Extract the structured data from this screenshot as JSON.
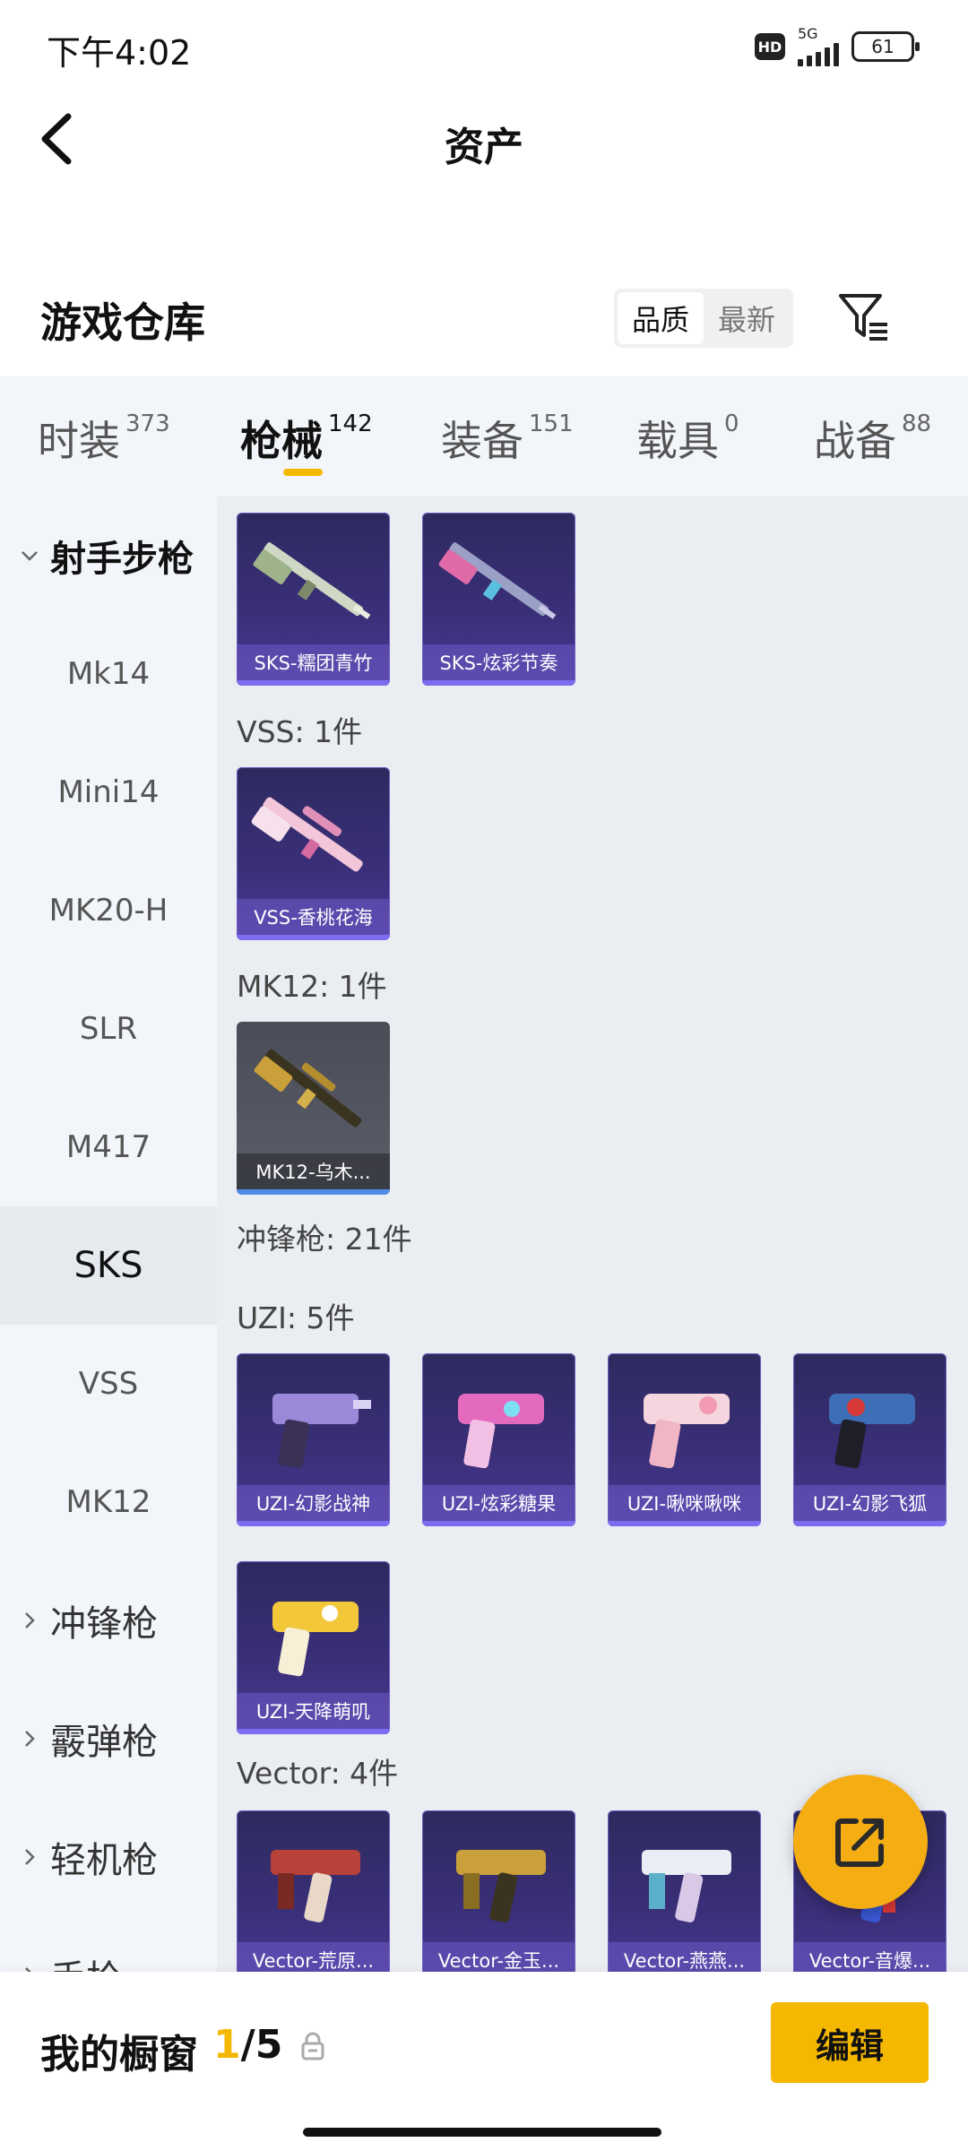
{
  "status_bar": {
    "time": "下午4:02",
    "hd": "HD",
    "network": "5G",
    "battery": "61"
  },
  "header": {
    "title": "资产"
  },
  "warehouse": {
    "title": "游戏仓库",
    "sort_options": [
      "品质",
      "最新"
    ],
    "active_sort": "品质"
  },
  "tabs": [
    {
      "label": "时装",
      "count": "373"
    },
    {
      "label": "枪械",
      "count": "142",
      "active": true
    },
    {
      "label": "装备",
      "count": "151"
    },
    {
      "label": "载具",
      "count": "0"
    },
    {
      "label": "战备",
      "count": "88"
    }
  ],
  "sidebar": {
    "group_expanded": "射手步枪",
    "items": [
      "Mk14",
      "Mini14",
      "MK20-H",
      "SLR",
      "M417",
      "SKS",
      "VSS",
      "MK12"
    ],
    "selected": "SKS",
    "collapsed_groups": [
      "冲锋枪",
      "霰弹枪",
      "轻机枪",
      "手枪"
    ]
  },
  "content": {
    "sks_cards": [
      "SKS-糯团青竹",
      "SKS-炫彩节奏"
    ],
    "vss_label": "VSS: 1件",
    "vss_cards": [
      "VSS-香桃花海"
    ],
    "mk12_label": "MK12: 1件",
    "mk12_cards": [
      "MK12-乌木..."
    ],
    "smg_label": "冲锋枪: 21件",
    "uzi_label": "UZI: 5件",
    "uzi_cards": [
      "UZI-幻影战神",
      "UZI-炫彩糖果",
      "UZI-啾咪啾咪",
      "UZI-幻影飞狐",
      "UZI-天降萌叽"
    ],
    "vector_label": "Vector: 4件",
    "vector_cards": [
      "Vector-荒原...",
      "Vector-金玉...",
      "Vector-燕燕...",
      "Vector-音爆..."
    ]
  },
  "bottom_bar": {
    "showcase_label": "我的橱窗",
    "showcase_current": "1",
    "showcase_total": "/5",
    "edit_label": "编辑"
  },
  "colors": {
    "accent": "#f5b800",
    "card_purple": "#3b2f7a",
    "fab": "#f5ad14"
  }
}
